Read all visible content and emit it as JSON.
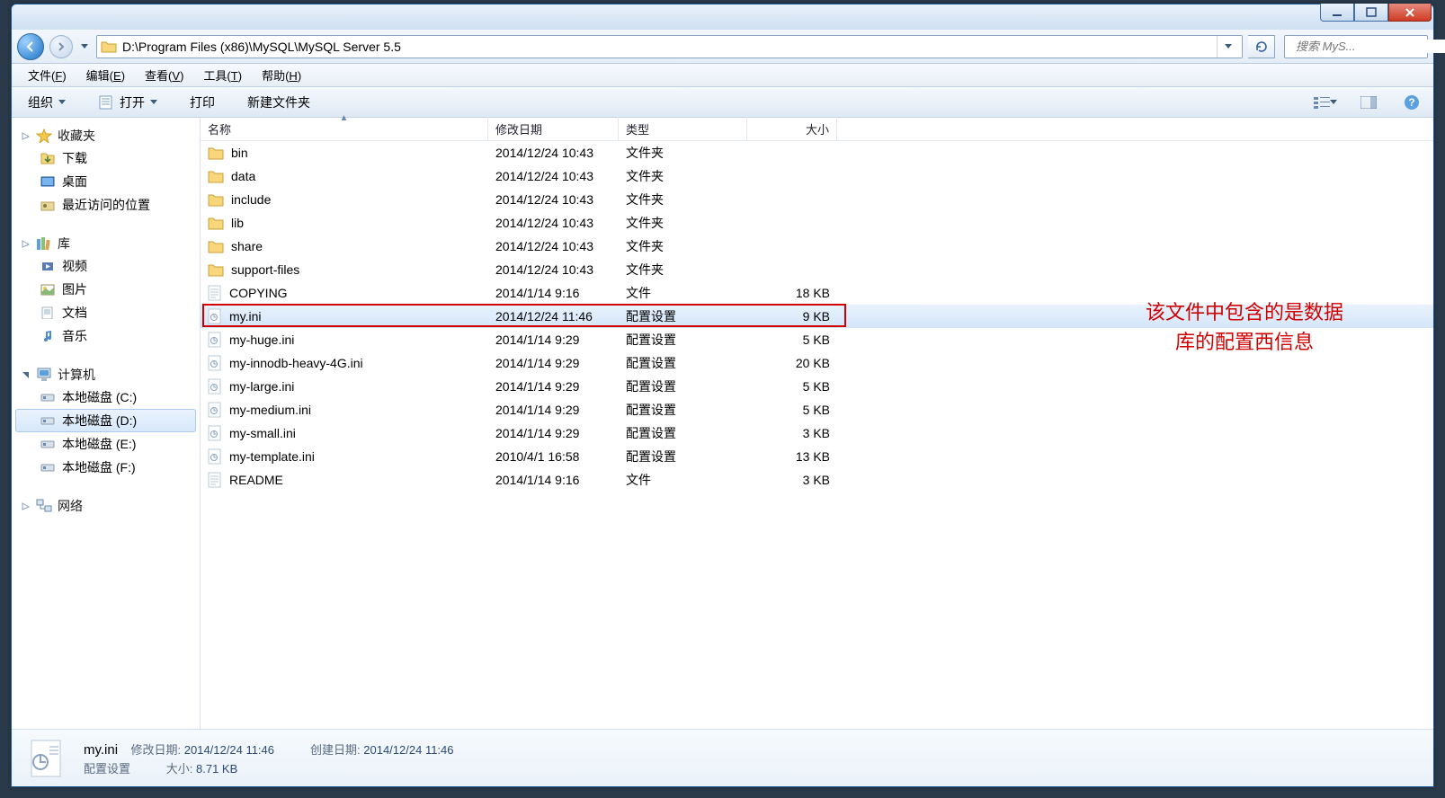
{
  "address_path": "D:\\Program Files (x86)\\MySQL\\MySQL Server 5.5",
  "search_placeholder": "搜索 MyS...",
  "menu": {
    "file": "文件",
    "edit": "编辑",
    "view": "查看",
    "tools": "工具",
    "help": "帮助",
    "file_k": "F",
    "edit_k": "E",
    "view_k": "V",
    "tools_k": "T",
    "help_k": "H"
  },
  "toolbar": {
    "organize": "组织",
    "open": "打开",
    "print": "打印",
    "new_folder": "新建文件夹"
  },
  "nav": {
    "favorites": {
      "label": "收藏夹",
      "items": [
        {
          "label": "下载"
        },
        {
          "label": "桌面"
        },
        {
          "label": "最近访问的位置"
        }
      ]
    },
    "libraries": {
      "label": "库",
      "items": [
        {
          "label": "视频"
        },
        {
          "label": "图片"
        },
        {
          "label": "文档"
        },
        {
          "label": "音乐"
        }
      ]
    },
    "computer": {
      "label": "计算机",
      "items": [
        {
          "label": "本地磁盘 (C:)"
        },
        {
          "label": "本地磁盘 (D:)",
          "selected": true
        },
        {
          "label": "本地磁盘 (E:)"
        },
        {
          "label": "本地磁盘 (F:)"
        }
      ]
    },
    "network": {
      "label": "网络"
    }
  },
  "columns": {
    "name": "名称",
    "date": "修改日期",
    "type": "类型",
    "size": "大小"
  },
  "files": [
    {
      "name": "bin",
      "date": "2014/12/24 10:43",
      "type": "文件夹",
      "size": "",
      "folder": true
    },
    {
      "name": "data",
      "date": "2014/12/24 10:43",
      "type": "文件夹",
      "size": "",
      "folder": true
    },
    {
      "name": "include",
      "date": "2014/12/24 10:43",
      "type": "文件夹",
      "size": "",
      "folder": true
    },
    {
      "name": "lib",
      "date": "2014/12/24 10:43",
      "type": "文件夹",
      "size": "",
      "folder": true
    },
    {
      "name": "share",
      "date": "2014/12/24 10:43",
      "type": "文件夹",
      "size": "",
      "folder": true
    },
    {
      "name": "support-files",
      "date": "2014/12/24 10:43",
      "type": "文件夹",
      "size": "",
      "folder": true
    },
    {
      "name": "COPYING",
      "date": "2014/1/14 9:16",
      "type": "文件",
      "size": "18 KB",
      "folder": false,
      "text": true
    },
    {
      "name": "my.ini",
      "date": "2014/12/24 11:46",
      "type": "配置设置",
      "size": "9 KB",
      "folder": false,
      "selected": true,
      "highlighted": true
    },
    {
      "name": "my-huge.ini",
      "date": "2014/1/14 9:29",
      "type": "配置设置",
      "size": "5 KB",
      "folder": false
    },
    {
      "name": "my-innodb-heavy-4G.ini",
      "date": "2014/1/14 9:29",
      "type": "配置设置",
      "size": "20 KB",
      "folder": false
    },
    {
      "name": "my-large.ini",
      "date": "2014/1/14 9:29",
      "type": "配置设置",
      "size": "5 KB",
      "folder": false
    },
    {
      "name": "my-medium.ini",
      "date": "2014/1/14 9:29",
      "type": "配置设置",
      "size": "5 KB",
      "folder": false
    },
    {
      "name": "my-small.ini",
      "date": "2014/1/14 9:29",
      "type": "配置设置",
      "size": "3 KB",
      "folder": false
    },
    {
      "name": "my-template.ini",
      "date": "2010/4/1 16:58",
      "type": "配置设置",
      "size": "13 KB",
      "folder": false
    },
    {
      "name": "README",
      "date": "2014/1/14 9:16",
      "type": "文件",
      "size": "3 KB",
      "folder": false,
      "text": true
    }
  ],
  "annotation": {
    "line1": "该文件中包含的是数据",
    "line2": "库的配置西信息"
  },
  "details": {
    "name": "my.ini",
    "type": "配置设置",
    "mod_label": "修改日期:",
    "mod_value": "2014/12/24 11:46",
    "create_label": "创建日期:",
    "create_value": "2014/12/24 11:46",
    "size_label": "大小:",
    "size_value": "8.71 KB"
  }
}
